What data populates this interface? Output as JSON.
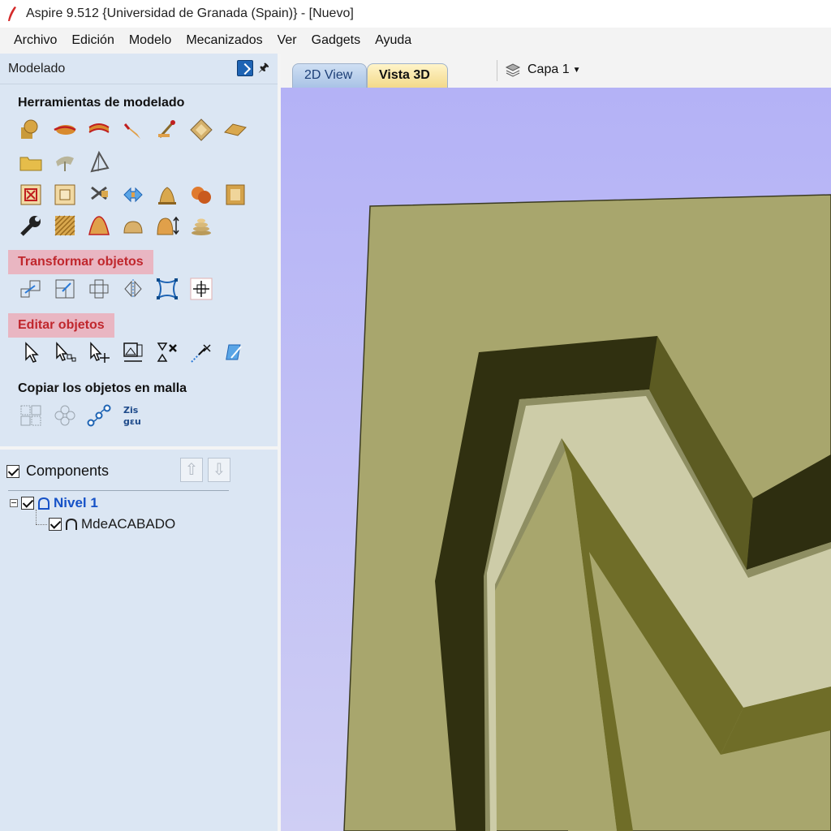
{
  "window": {
    "title": "Aspire 9.512 {Universidad de Granada (Spain)} - [Nuevo]"
  },
  "menu": [
    "Archivo",
    "Edición",
    "Modelo",
    "Mecanizados",
    "Ver",
    "Gadgets",
    "Ayuda"
  ],
  "panel": {
    "title": "Modelado",
    "sections": {
      "modeling_tools": "Herramientas de modelado",
      "transform": "Transformar objetos",
      "edit": "Editar objetos",
      "array_copy": "Copiar los objetos en malla"
    },
    "highlight_color": "#e9b6c2",
    "components": {
      "title": "Components",
      "tree": [
        {
          "label": "Nivel 1",
          "checked": true,
          "expanded": true
        },
        {
          "label": "MdeACABADO",
          "checked": true
        }
      ]
    }
  },
  "view": {
    "tabs": [
      "2D View",
      "Vista 3D"
    ],
    "active_tab": "Vista 3D",
    "layer": "Capa 1",
    "background_color": "#b9b8f6",
    "model_color": "#a7a56d"
  },
  "icons": {
    "modeling_row1": [
      "shapes-icon",
      "sweep-one-rail-icon",
      "sweep-two-rail-icon",
      "extrude-icon",
      "sculpt-icon",
      "weave-icon",
      "flat-plane-icon"
    ],
    "modeling_row2": [
      "open-folder-icon",
      "create-shape-icon",
      "pyramid-icon"
    ],
    "modeling_row3": [
      "create-component-icon",
      "square-component-icon",
      "scissors-icon",
      "mirror-icon",
      "bell-shape-icon",
      "spheres-icon",
      "frame-icon"
    ],
    "modeling_row4": [
      "wrench-icon",
      "texture-icon",
      "dome-icon",
      "half-sphere-icon",
      "dome-height-icon",
      "stacked-discs-icon"
    ],
    "transform_row": [
      "move-icon",
      "scale-icon",
      "rotate-icon",
      "mirror-horizontal-icon",
      "distort-icon",
      "center-icon"
    ],
    "edit_row": [
      "select-icon",
      "node-edit-icon",
      "transform-select-icon",
      "clip-icon",
      "delete-icon",
      "interactive-trim-icon",
      "join-icon"
    ],
    "array_row": [
      "grid-array-icon",
      "circular-array-icon",
      "copy-along-path-icon",
      "nesting-icon"
    ]
  }
}
